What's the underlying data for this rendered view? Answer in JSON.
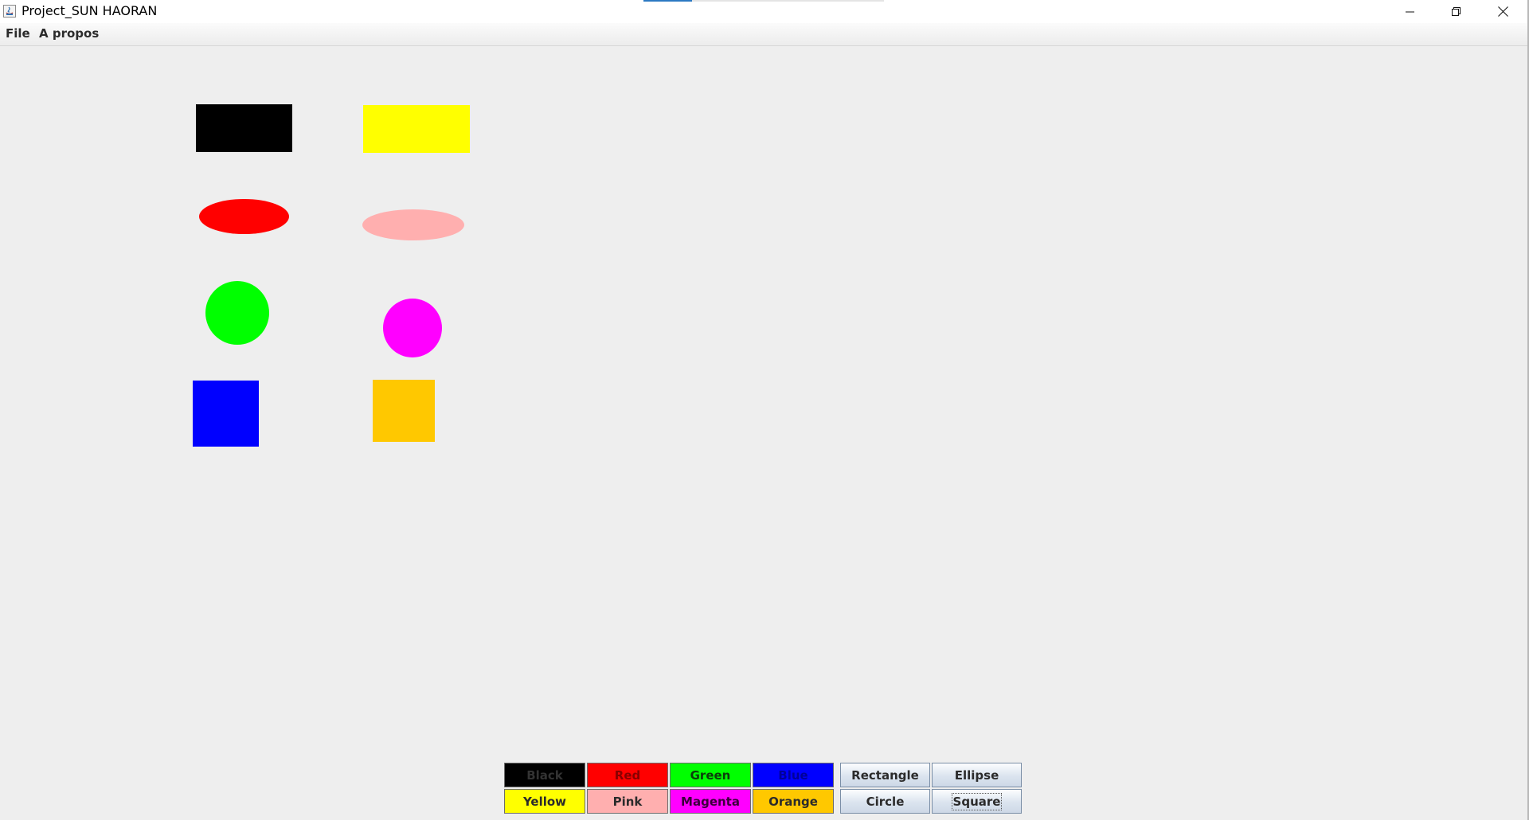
{
  "window": {
    "title": "Project_SUN HAORAN"
  },
  "menubar": {
    "items": [
      {
        "label": "File"
      },
      {
        "label": "A propos"
      }
    ]
  },
  "canvas": {
    "shapes": [
      {
        "type": "rectangle",
        "color": "#000000"
      },
      {
        "type": "rectangle",
        "color": "#ffff00"
      },
      {
        "type": "ellipse",
        "color": "#ff0000"
      },
      {
        "type": "ellipse",
        "color": "#ffafaf"
      },
      {
        "type": "circle",
        "color": "#00ff00"
      },
      {
        "type": "circle",
        "color": "#ff00ff"
      },
      {
        "type": "square",
        "color": "#0000ff"
      },
      {
        "type": "square",
        "color": "#ffc800"
      }
    ]
  },
  "toolbar": {
    "colors": [
      {
        "label": "Black",
        "bg": "#000000",
        "fg": "#333333"
      },
      {
        "label": "Red",
        "bg": "#ff0000",
        "fg": "#880000"
      },
      {
        "label": "Green",
        "bg": "#00ff00",
        "fg": "#0b3d0b"
      },
      {
        "label": "Blue",
        "bg": "#0000ff",
        "fg": "#000099"
      },
      {
        "label": "Yellow",
        "bg": "#ffff00",
        "fg": "#2b2b2b"
      },
      {
        "label": "Pink",
        "bg": "#ffafaf",
        "fg": "#2b2b2b"
      },
      {
        "label": "Magenta",
        "bg": "#ff00ff",
        "fg": "#3b003b"
      },
      {
        "label": "Orange",
        "bg": "#ffc800",
        "fg": "#2b2b2b"
      }
    ],
    "shapes": [
      {
        "label": "Rectangle"
      },
      {
        "label": "Ellipse"
      },
      {
        "label": "Circle"
      },
      {
        "label": "Square"
      }
    ]
  }
}
